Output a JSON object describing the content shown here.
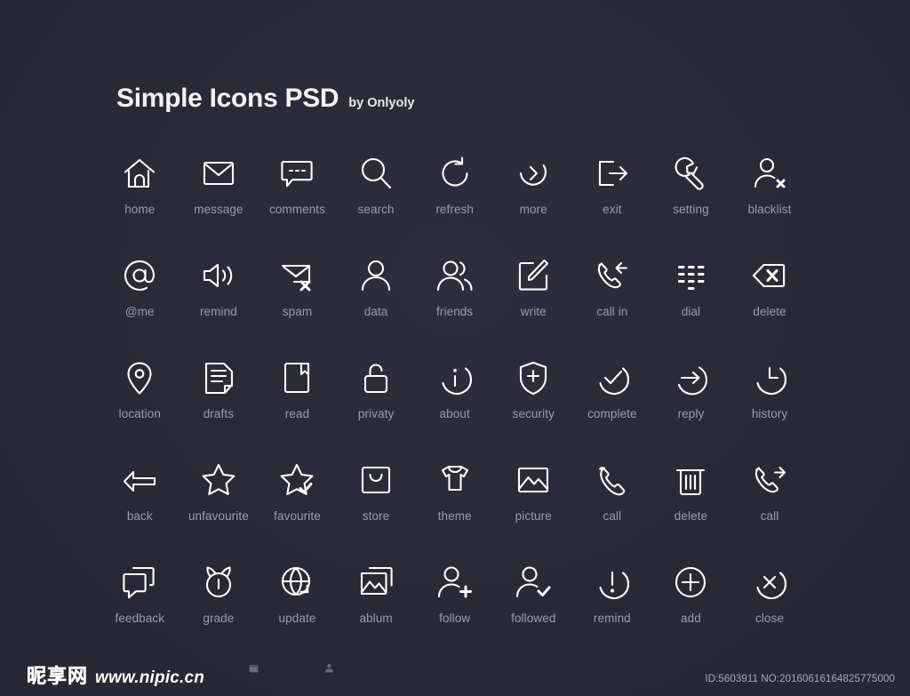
{
  "header": {
    "title": "Simple Icons PSD",
    "byline": "by Onlyoly"
  },
  "background_color": "#2b2b3b",
  "icon_color": "#ffffff",
  "label_color": "#9c9cab",
  "grid": {
    "columns": 9,
    "rows": 5,
    "items": [
      {
        "label": "home",
        "icon": "home-icon"
      },
      {
        "label": "message",
        "icon": "envelope-icon"
      },
      {
        "label": "comments",
        "icon": "speech-bubble-dots-icon"
      },
      {
        "label": "search",
        "icon": "magnifier-icon"
      },
      {
        "label": "refresh",
        "icon": "refresh-arrow-icon"
      },
      {
        "label": "more",
        "icon": "chevron-right-circle-icon"
      },
      {
        "label": "exit",
        "icon": "exit-arrow-icon"
      },
      {
        "label": "setting",
        "icon": "wrench-icon"
      },
      {
        "label": "blacklist",
        "icon": "user-x-icon"
      },
      {
        "label": "@me",
        "icon": "at-sign-icon"
      },
      {
        "label": "remind",
        "icon": "speaker-icon"
      },
      {
        "label": "spam",
        "icon": "envelope-x-icon"
      },
      {
        "label": "data",
        "icon": "user-icon"
      },
      {
        "label": "friends",
        "icon": "users-icon"
      },
      {
        "label": "write",
        "icon": "pencil-square-icon"
      },
      {
        "label": "call in",
        "icon": "phone-incoming-icon"
      },
      {
        "label": "dial",
        "icon": "dial-pad-icon"
      },
      {
        "label": "delete",
        "icon": "backspace-x-icon"
      },
      {
        "label": "location",
        "icon": "map-pin-icon"
      },
      {
        "label": "drafts",
        "icon": "draft-page-icon"
      },
      {
        "label": "read",
        "icon": "book-icon"
      },
      {
        "label": "privaty",
        "icon": "open-lock-icon"
      },
      {
        "label": "about",
        "icon": "info-circle-icon"
      },
      {
        "label": "security",
        "icon": "shield-plus-icon"
      },
      {
        "label": "complete",
        "icon": "check-circle-icon"
      },
      {
        "label": "reply",
        "icon": "arrow-right-circle-icon"
      },
      {
        "label": "history",
        "icon": "clock-icon"
      },
      {
        "label": "back",
        "icon": "arrow-left-icon"
      },
      {
        "label": "unfavourite",
        "icon": "star-outline-icon"
      },
      {
        "label": "favourite",
        "icon": "star-check-icon"
      },
      {
        "label": "store",
        "icon": "shopping-bag-icon"
      },
      {
        "label": "theme",
        "icon": "tshirt-icon"
      },
      {
        "label": "picture",
        "icon": "image-icon"
      },
      {
        "label": "call",
        "icon": "phone-icon"
      },
      {
        "label": "delete",
        "icon": "trash-icon"
      },
      {
        "label": "call",
        "icon": "phone-outgoing-icon"
      },
      {
        "label": "feedback",
        "icon": "chat-windows-icon"
      },
      {
        "label": "grade",
        "icon": "medal-icon"
      },
      {
        "label": "update",
        "icon": "globe-update-icon"
      },
      {
        "label": "ablum",
        "icon": "photos-stack-icon"
      },
      {
        "label": "follow",
        "icon": "user-plus-icon"
      },
      {
        "label": "followed",
        "icon": "user-check-icon"
      },
      {
        "label": "remind",
        "icon": "exclamation-circle-icon"
      },
      {
        "label": "add",
        "icon": "plus-circle-icon"
      },
      {
        "label": "close",
        "icon": "x-circle-icon"
      }
    ]
  },
  "footer": {
    "watermark_cn": "昵享网",
    "watermark_url": "www.nipic.cn",
    "id_stamp": "ID:5603911 NO:20160616164825775000"
  }
}
